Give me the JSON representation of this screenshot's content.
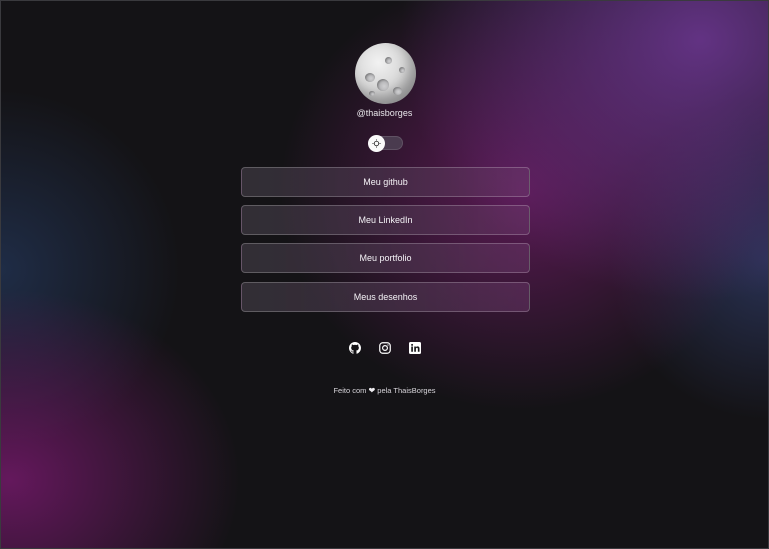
{
  "profile": {
    "username": "@thaisborges",
    "avatar_icon": "moon-icon"
  },
  "theme_toggle": {
    "icon": "sun-icon",
    "state": "off"
  },
  "links": [
    {
      "label": "Meu github"
    },
    {
      "label": "Meu LinkedIn"
    },
    {
      "label": "Meu portfolio"
    },
    {
      "label": "Meus desenhos"
    }
  ],
  "social": [
    {
      "name": "github",
      "icon": "github-icon"
    },
    {
      "name": "instagram",
      "icon": "instagram-icon"
    },
    {
      "name": "linkedin",
      "icon": "linkedin-icon"
    }
  ],
  "footer": {
    "prefix": "Feito com",
    "heart": "❤",
    "suffix": "pela ThaisBorges"
  },
  "colors": {
    "background": "#141316",
    "accent_purple": "#703896",
    "accent_magenta": "#731c69"
  }
}
